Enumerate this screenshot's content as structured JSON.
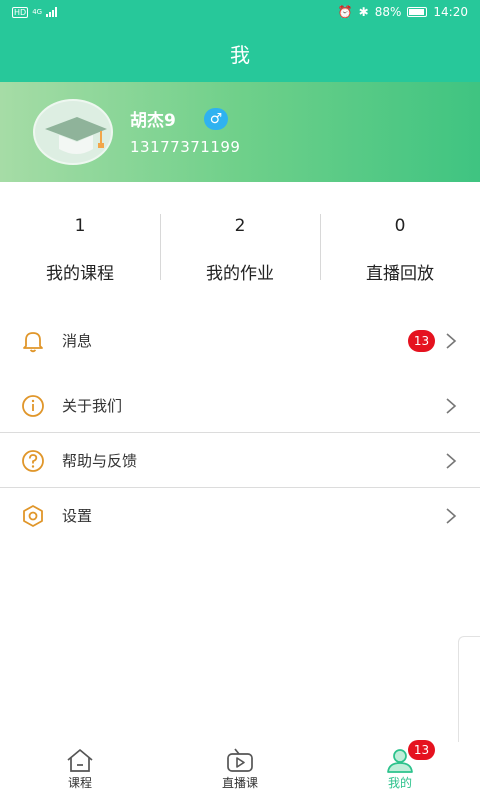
{
  "status_bar": {
    "network": "HD",
    "signal": "4G",
    "battery": "88%",
    "time": "14:20"
  },
  "header": {
    "title": "我"
  },
  "profile": {
    "name": "胡杰9",
    "gender_symbol": "♂",
    "phone": "13177371199"
  },
  "stats": [
    {
      "value": "1",
      "label": "我的课程"
    },
    {
      "value": "2",
      "label": "我的作业"
    },
    {
      "value": "0",
      "label": "直播回放"
    }
  ],
  "menu": [
    {
      "label": "消息",
      "badge": "13",
      "icon": "bell-icon"
    },
    {
      "label": "关于我们",
      "icon": "info-icon"
    },
    {
      "label": "帮助与反馈",
      "icon": "question-icon"
    },
    {
      "label": "设置",
      "icon": "settings-hexagon-icon"
    }
  ],
  "tabbar": {
    "tabs": [
      {
        "label": "课程",
        "icon": "home-icon"
      },
      {
        "label": "直播课",
        "icon": "tv-play-icon"
      },
      {
        "label": "我的",
        "icon": "user-icon",
        "badge": "13",
        "active": true
      }
    ]
  },
  "colors": {
    "primary": "#27c89a",
    "badge": "#e5121f",
    "icon_orange": "#e0962a"
  }
}
